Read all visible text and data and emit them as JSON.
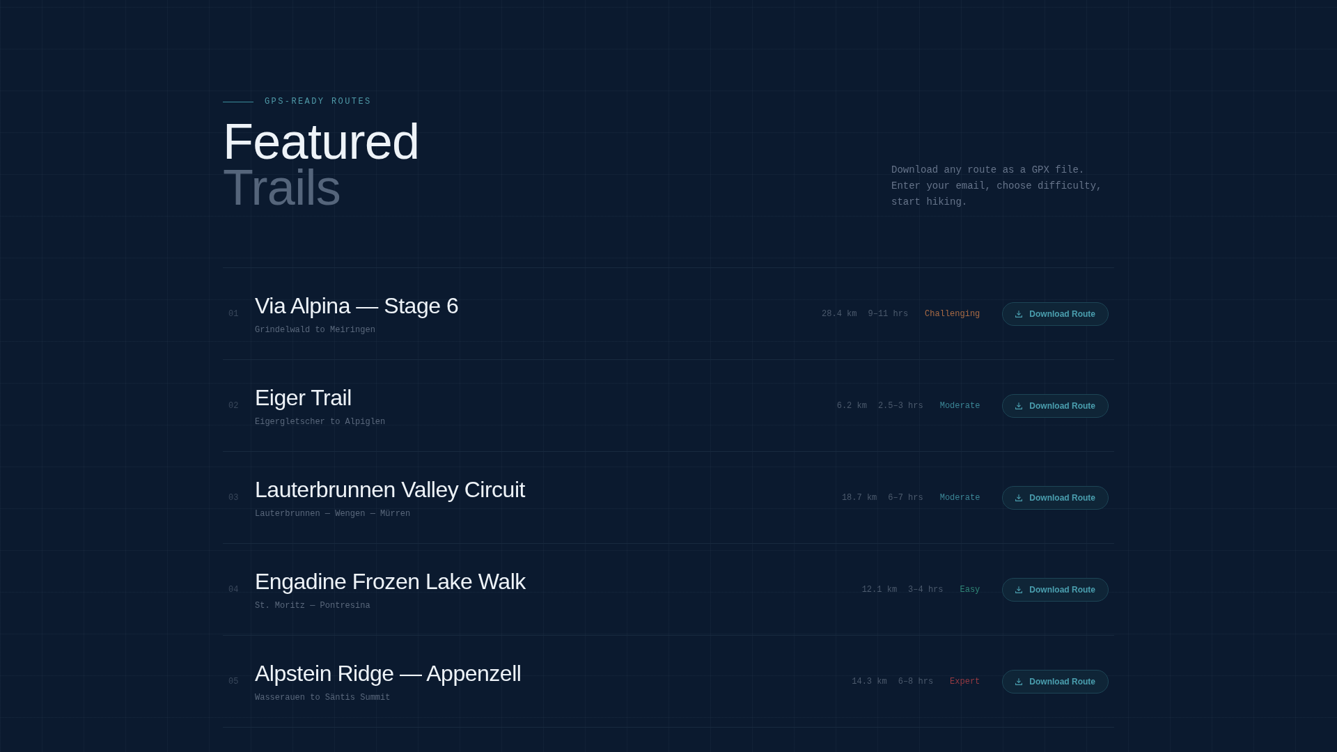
{
  "eyebrow": "GPS-READY ROUTES",
  "heading": {
    "line_1": "Featured",
    "line_2": "Trails"
  },
  "description": "Download any route as a GPX file. Enter your email, choose difficulty, start hiking.",
  "trails": [
    {
      "number": "01",
      "name": "Via Alpina — Stage 6",
      "route": "Grindelwald to Meiringen",
      "distance": "28.4 km",
      "duration": "9–11 hrs",
      "difficulty": {
        "label": "Challenging",
        "color": "#a86a44"
      },
      "button": "Download Route"
    },
    {
      "number": "02",
      "name": "Eiger Trail",
      "route": "Eigergletscher to Alpiglen",
      "distance": "6.2 km",
      "duration": "2.5–3 hrs",
      "difficulty": {
        "label": "Moderate",
        "color": "#3b8595"
      },
      "button": "Download Route"
    },
    {
      "number": "03",
      "name": "Lauterbrunnen Valley Circuit",
      "route": "Lauterbrunnen — Wengen — Mürren",
      "distance": "18.7 km",
      "duration": "6–7 hrs",
      "difficulty": {
        "label": "Moderate",
        "color": "#3b8595"
      },
      "button": "Download Route"
    },
    {
      "number": "04",
      "name": "Engadine Frozen Lake Walk",
      "route": "St. Moritz — Pontresina",
      "distance": "12.1 km",
      "duration": "3–4 hrs",
      "difficulty": {
        "label": "Easy",
        "color": "#2f8676"
      },
      "button": "Download Route"
    },
    {
      "number": "05",
      "name": "Alpstein Ridge — Appenzell",
      "route": "Wasserauen to Säntis Summit",
      "distance": "14.3 km",
      "duration": "6–8 hrs",
      "difficulty": {
        "label": "Expert",
        "color": "#963a42"
      },
      "button": "Download Route"
    }
  ]
}
